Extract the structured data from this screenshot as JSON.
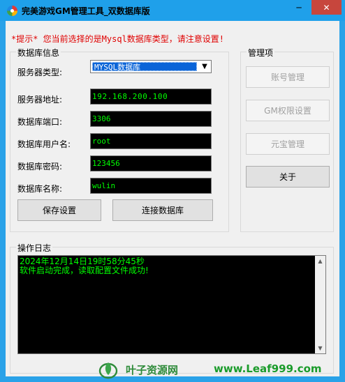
{
  "window": {
    "title": "完美游戏GM管理工具_双数据库版",
    "minimize_glyph": "─",
    "close_glyph": "✕"
  },
  "hint": "*提示*  您当前选择的是Mysql数据库类型，请注意设置!",
  "db_group": {
    "legend": "数据库信息",
    "server_type_label": "服务器类型:",
    "server_type_value": "MYSQL数据库",
    "server_addr_label": "服务器地址:",
    "server_addr_value": "192.168.200.100",
    "port_label": "数据库端口:",
    "port_value": "3306",
    "user_label": "数据库用户名:",
    "user_value": "root",
    "password_label": "数据库密码:",
    "password_value": "123456",
    "dbname_label": "数据库名称:",
    "dbname_value": "wulin",
    "save_button": "保存设置",
    "connect_button": "连接数据库"
  },
  "manager_group": {
    "legend": "管理项",
    "account_button": "账号管理",
    "gm_button": "GM权限设置",
    "yuanbao_button": "元宝管理",
    "about_button": "关于"
  },
  "log_group": {
    "legend": "操作日志",
    "log_text": "2024年12月14日19时58分45秒\n软件启动完成，读取配置文件成功!"
  },
  "watermark": {
    "site_name": "叶子资源网",
    "url": "www.Leaf999.com",
    "brand_color": "#2e8b3a"
  },
  "colors": {
    "titlebar": "#1fa0ea",
    "close_button": "#c7463d",
    "hint": "#e00000",
    "field_bg": "#000000",
    "field_text": "#00ff00"
  }
}
